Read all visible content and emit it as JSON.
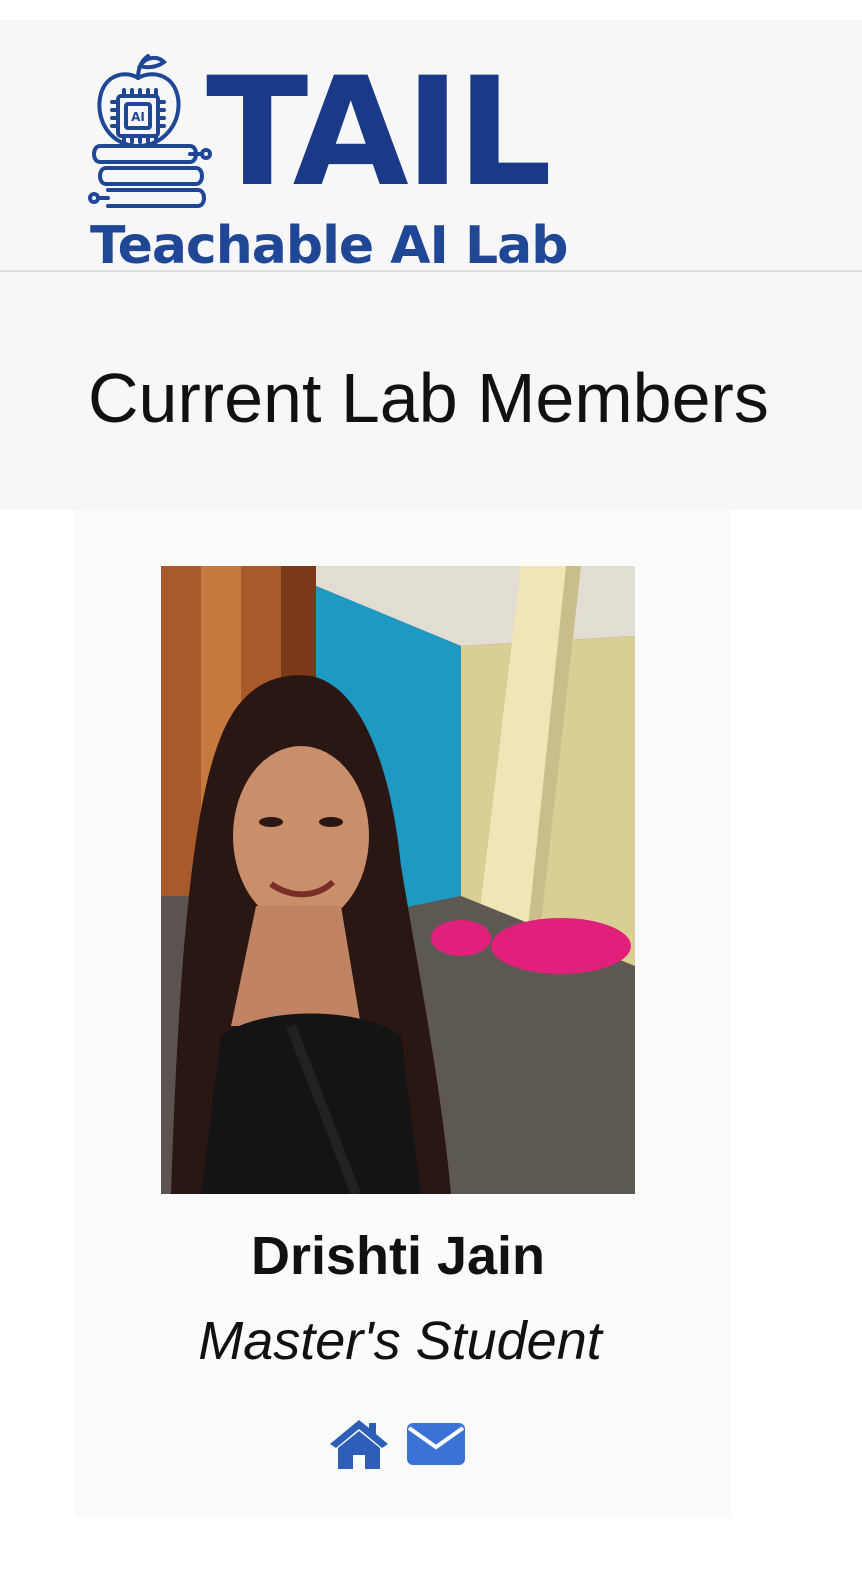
{
  "header": {
    "logo_word": "TAIL",
    "logo_sub": "Teachable AI Lab",
    "chip_label": "AI",
    "brand_color": "#1a3a87"
  },
  "page": {
    "title": "Current Lab Members"
  },
  "members": [
    {
      "name": "Drishti Jain",
      "role": "Master's Student",
      "links": [
        {
          "icon": "home-icon",
          "color": "#2d5fb8"
        },
        {
          "icon": "mail-icon",
          "color": "#3b72d6"
        }
      ]
    }
  ]
}
